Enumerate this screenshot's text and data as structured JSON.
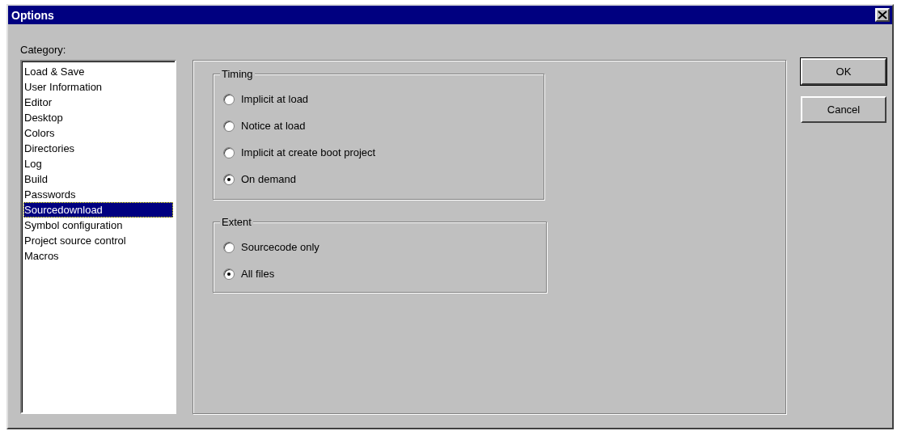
{
  "window": {
    "title": "Options"
  },
  "category": {
    "label": "Category:",
    "items": [
      {
        "label": "Load & Save",
        "selected": false
      },
      {
        "label": "User Information",
        "selected": false
      },
      {
        "label": "Editor",
        "selected": false
      },
      {
        "label": "Desktop",
        "selected": false
      },
      {
        "label": "Colors",
        "selected": false
      },
      {
        "label": "Directories",
        "selected": false
      },
      {
        "label": "Log",
        "selected": false
      },
      {
        "label": "Build",
        "selected": false
      },
      {
        "label": "Passwords",
        "selected": false
      },
      {
        "label": "Sourcedownload",
        "selected": true
      },
      {
        "label": "Symbol configuration",
        "selected": false
      },
      {
        "label": "Project source control",
        "selected": false
      },
      {
        "label": "Macros",
        "selected": false
      }
    ]
  },
  "groups": [
    {
      "title": "Timing",
      "options": [
        {
          "label": "Implicit at load",
          "selected": false
        },
        {
          "label": "Notice at load",
          "selected": false
        },
        {
          "label": "Implicit at create boot project",
          "selected": false
        },
        {
          "label": "On demand",
          "selected": true
        }
      ]
    },
    {
      "title": "Extent",
      "options": [
        {
          "label": "Sourcecode only",
          "selected": false
        },
        {
          "label": "All files",
          "selected": true
        }
      ]
    }
  ],
  "buttons": [
    {
      "label": "OK",
      "default": true
    },
    {
      "label": "Cancel",
      "default": false
    }
  ]
}
